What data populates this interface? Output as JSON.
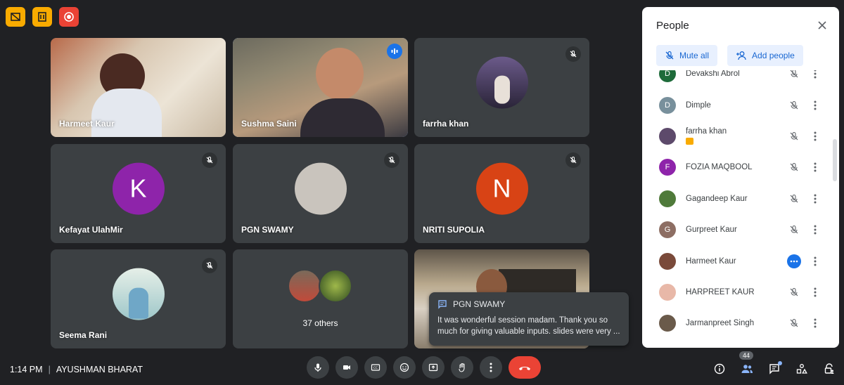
{
  "tiles": [
    {
      "name": "Harmeet Kaur"
    },
    {
      "name": "Sushma Saini"
    },
    {
      "name": "farrha khan"
    },
    {
      "name": "Kefayat UlahMir",
      "initial": "K"
    },
    {
      "name": "PGN SWAMY"
    },
    {
      "name": "NRITI SUPOLIA",
      "initial": "N"
    },
    {
      "name": "Seema Rani"
    },
    {
      "name": "37 others"
    }
  ],
  "chat": {
    "from": "PGN SWAMY",
    "message": "It was wonderful session madam. Thank you so much for giving valuable inputs. slides were very ..."
  },
  "panel": {
    "title": "People",
    "mute_all": "Mute all",
    "add_people": "Add people",
    "people": [
      {
        "name": "Devakshi Abrol",
        "initial": "D",
        "color": "#1e6b3a"
      },
      {
        "name": "Dimple",
        "initial": "D",
        "color": "#78909c"
      },
      {
        "name": "farrha khan",
        "initial": "",
        "color": "#5d4a6b"
      },
      {
        "name": "FOZIA MAQBOOL",
        "initial": "F",
        "color": "#8e24aa"
      },
      {
        "name": "Gagandeep Kaur",
        "initial": "",
        "color": "#4f7a3a"
      },
      {
        "name": "Gurpreet Kaur",
        "initial": "G",
        "color": "#8d6e63"
      },
      {
        "name": "Harmeet Kaur",
        "initial": "",
        "color": "#7a4a3a"
      },
      {
        "name": "HARPREET KAUR",
        "initial": "",
        "color": "#e8b8a8"
      },
      {
        "name": "Jarmanpreet Singh",
        "initial": "",
        "color": "#6a5a4a"
      }
    ]
  },
  "meeting": {
    "time": "1:14 PM",
    "separator": "|",
    "name": "AYUSHMAN BHARAT"
  },
  "participants_count": "44",
  "colors": {
    "accent": "#8ab4f8",
    "end_call": "#ea4335",
    "tile_bg": "#3c4043",
    "avatar_k": "#8e24aa",
    "avatar_n": "#d84315"
  }
}
